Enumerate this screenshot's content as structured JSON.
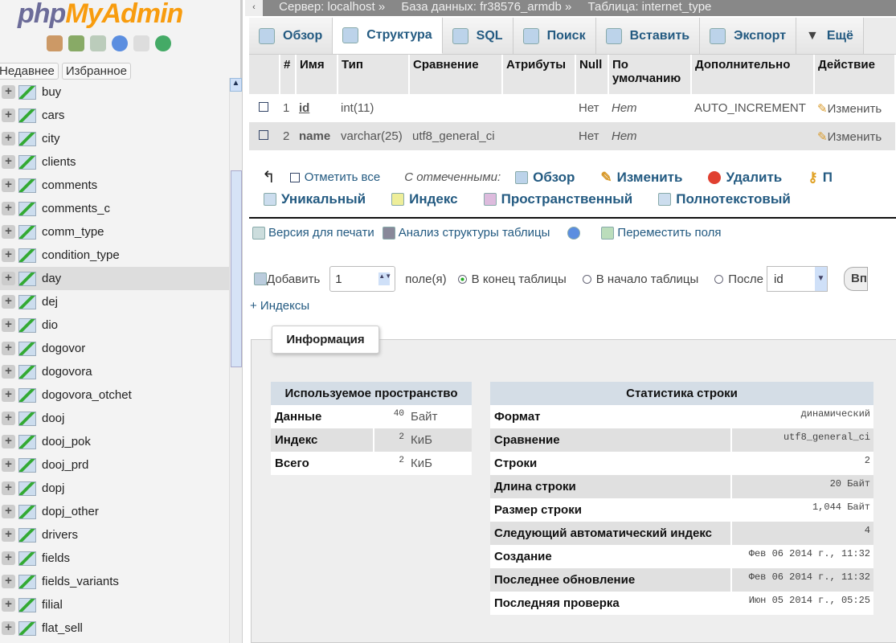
{
  "sidebar": {
    "logo_php": "php",
    "logo_my": "MyAdmin",
    "tabs": [
      "Недавнее",
      "Избранное"
    ],
    "items": [
      "buy",
      "cars",
      "city",
      "clients",
      "comments",
      "comments_c",
      "comm_type",
      "condition_type",
      "day",
      "dej",
      "dio",
      "dogovor",
      "dogovora",
      "dogovora_otchet",
      "dooj",
      "dooj_pok",
      "dooj_prd",
      "dopj",
      "dopj_other",
      "drivers",
      "fields",
      "fields_variants",
      "filial",
      "flat_sell"
    ],
    "selected": "day"
  },
  "breadcrumb": {
    "server": "Сервер: localhost »",
    "db": "База данных: fr38576_armdb »",
    "table": "Таблица: internet_type"
  },
  "tabs": [
    "Обзор",
    "Структура",
    "SQL",
    "Поиск",
    "Вставить",
    "Экспорт",
    "Ещё"
  ],
  "structure": {
    "headers": [
      "#",
      "Имя",
      "Тип",
      "Сравнение",
      "Атрибуты",
      "Null",
      "По умолчанию",
      "Дополнительно",
      "Действие"
    ],
    "rows": [
      {
        "n": "1",
        "name": "id",
        "type": "int(11)",
        "coll": "",
        "attr": "",
        "null": "Нет",
        "default": "Нет",
        "extra": "AUTO_INCREMENT",
        "action": "Изменить"
      },
      {
        "n": "2",
        "name": "name",
        "type": "varchar(25)",
        "coll": "utf8_general_ci",
        "attr": "",
        "null": "Нет",
        "default": "Нет",
        "extra": "",
        "action": "Изменить"
      }
    ]
  },
  "bulk": {
    "check_all": "Отметить все",
    "with_selected": "С отмеченными:",
    "actions": [
      "Обзор",
      "Изменить",
      "Удалить",
      "П"
    ],
    "actions2": [
      "Уникальный",
      "Индекс",
      "Пространственный",
      "Полнотекстовый"
    ]
  },
  "tools": [
    "Версия для печати",
    "Анализ структуры таблицы",
    "Переместить поля"
  ],
  "add": {
    "label": "Добавить",
    "count": "1",
    "fields": "поле(я)",
    "opt_end": "В конец таблицы",
    "opt_begin": "В начало таблицы",
    "opt_after": "После",
    "after_value": "id",
    "go": "Вп"
  },
  "indexes_link": "+ Индексы",
  "info": {
    "title": "Информация",
    "space": {
      "header": "Используемое пространство",
      "rows": [
        [
          "Данные",
          "40",
          "Байт"
        ],
        [
          "Индекс",
          "2",
          "КиБ"
        ],
        [
          "Всего",
          "2",
          "КиБ"
        ]
      ]
    },
    "stats": {
      "header": "Статистика строки",
      "rows": [
        [
          "Формат",
          "динамический"
        ],
        [
          "Сравнение",
          "utf8_general_ci"
        ],
        [
          "Строки",
          "2"
        ],
        [
          "Длина строки",
          "20 Байт"
        ],
        [
          "Размер строки",
          "1,044 Байт"
        ],
        [
          "Следующий автоматический индекс",
          "4"
        ],
        [
          "Создание",
          "Фев 06 2014 г., 11:32"
        ],
        [
          "Последнее обновление",
          "Фев 06 2014 г., 11:32"
        ],
        [
          "Последняя проверка",
          "Июн 05 2014 г., 05:25"
        ]
      ]
    }
  }
}
